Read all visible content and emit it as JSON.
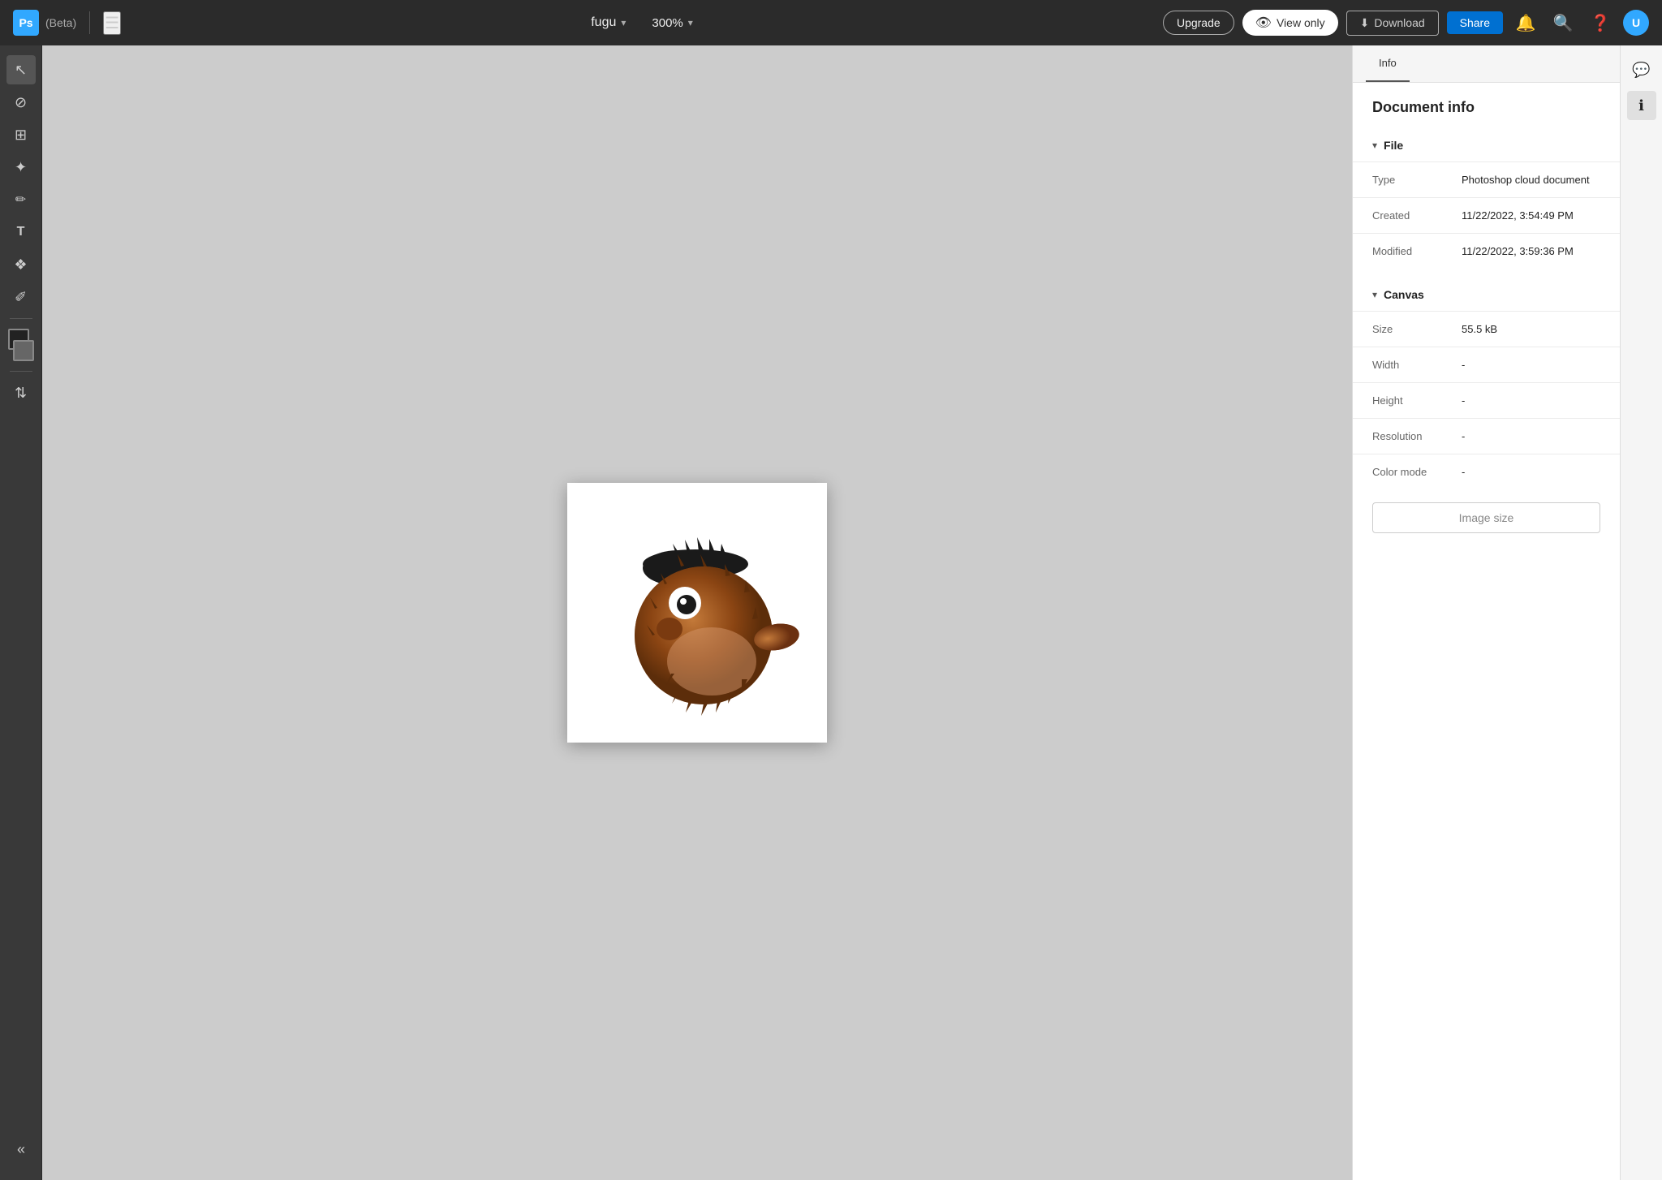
{
  "app": {
    "logo": "Ps",
    "beta_label": "(Beta)",
    "menu_icon": "≡"
  },
  "topbar": {
    "filename": "fugu",
    "zoom": "300%",
    "upgrade_label": "Upgrade",
    "viewonly_label": "View only",
    "download_label": "Download",
    "share_label": "Share",
    "avatar_initials": "U"
  },
  "toolbar": {
    "tools": [
      {
        "name": "select-tool",
        "icon": "↖",
        "active": true
      },
      {
        "name": "brush-tool",
        "icon": "⊘"
      },
      {
        "name": "transform-tool",
        "icon": "⊞"
      },
      {
        "name": "healing-tool",
        "icon": "✦"
      },
      {
        "name": "pen-tool",
        "icon": "✏"
      },
      {
        "name": "text-tool",
        "icon": "T"
      },
      {
        "name": "shape-tool",
        "icon": "❖"
      },
      {
        "name": "eyedropper-tool",
        "icon": "✐"
      },
      {
        "name": "swap-tool",
        "icon": "⇅"
      }
    ]
  },
  "document_info": {
    "title": "Document info",
    "file_section": "File",
    "canvas_section": "Canvas",
    "fields": {
      "type_label": "Type",
      "type_value": "Photoshop cloud document",
      "created_label": "Created",
      "created_value": "11/22/2022, 3:54:49 PM",
      "modified_label": "Modified",
      "modified_value": "11/22/2022, 3:59:36 PM",
      "size_label": "Size",
      "size_value": "55.5 kB",
      "width_label": "Width",
      "width_value": "-",
      "height_label": "Height",
      "height_value": "-",
      "resolution_label": "Resolution",
      "resolution_value": "-",
      "color_mode_label": "Color mode",
      "color_mode_value": "-"
    },
    "image_size_button": "Image size"
  },
  "side_icons": {
    "comment_icon": "💬",
    "info_icon": "ℹ"
  }
}
